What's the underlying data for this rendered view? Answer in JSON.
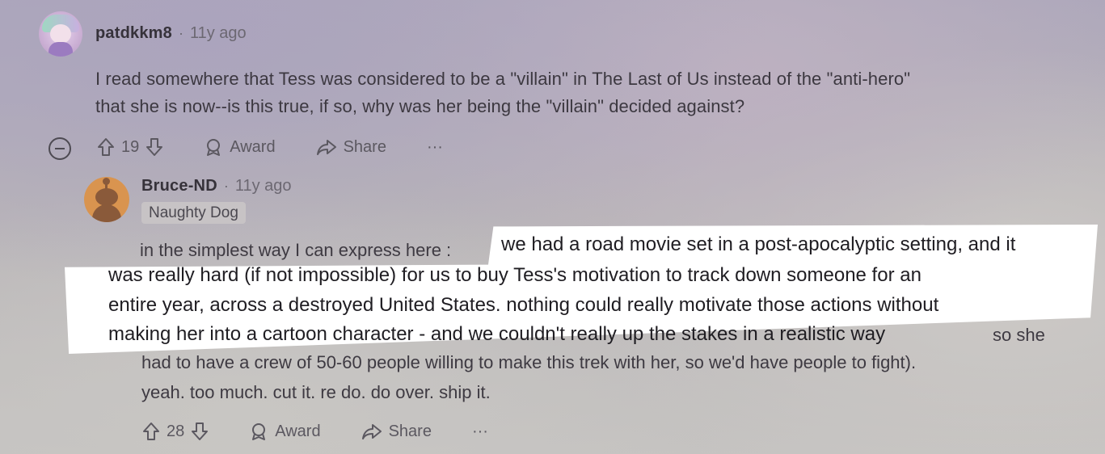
{
  "top_comment": {
    "author": "patdkkm8",
    "separator": "·",
    "time": "11y ago",
    "body_line1": "I read somewhere that Tess was considered to be a \"villain\" in The Last of Us instead of the \"anti-hero\"",
    "body_line2": "that she is now--is this true, if so, why was her being the \"villain\" decided against?",
    "actions": {
      "collapse_icon": "minus-circle-icon",
      "upvote_icon": "arrow-up-icon",
      "score": "19",
      "downvote_icon": "arrow-down-icon",
      "award_icon": "award-icon",
      "award_label": "Award",
      "share_icon": "share-icon",
      "share_label": "Share",
      "more_label": "···"
    }
  },
  "reply": {
    "author": "Bruce-ND",
    "separator": "·",
    "time": "11y ago",
    "flair": "Naughty Dog",
    "line1_lead": "in the simplest way I can express here :",
    "line1_highlight": "we had a road movie set in a post-apocalyptic setting, and it",
    "line2": "was really hard (if not impossible) for us to buy Tess's motivation to track down someone for an",
    "line3": "entire year, across a destroyed United States. nothing could really motivate those actions without",
    "line4_highlight": "making her into a cartoon character - and we couldn't really up the stakes in a realistic way",
    "line4_tail": "so she",
    "line5": "had to have a crew of 50-60 people willing to make this trek with her, so we'd have people to fight).",
    "line6": "yeah. too much. cut it. re do. do over. ship it.",
    "actions": {
      "upvote_icon": "arrow-up-icon",
      "score": "28",
      "downvote_icon": "arrow-down-icon",
      "award_icon": "award-icon",
      "award_label": "Award",
      "share_icon": "share-icon",
      "share_label": "Share",
      "more_label": "···"
    }
  },
  "colors": {
    "highlight_overlay": "#ffffff",
    "text_primary": "#3c3840",
    "text_muted": "#6c6872"
  }
}
